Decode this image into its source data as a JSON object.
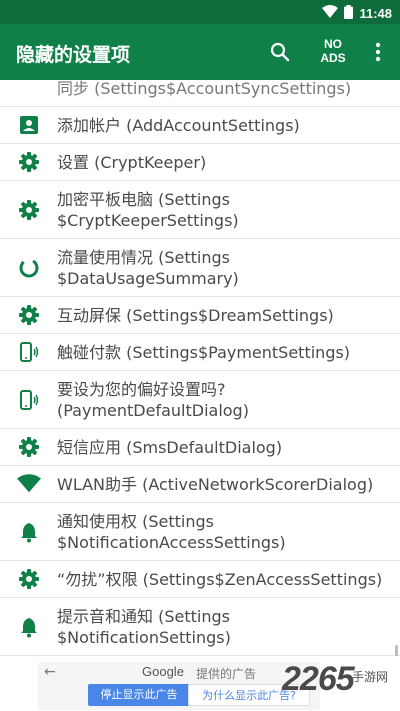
{
  "status_bar": {
    "time": "11:48",
    "icons": [
      "wifi-icon",
      "battery-icon"
    ]
  },
  "app_bar": {
    "title": "隐藏的设置项",
    "no_ads_line1": "NO",
    "no_ads_line2": "ADS",
    "icons": [
      "search-icon",
      "more-vert-icon"
    ]
  },
  "colors": {
    "primary": "#0f8048",
    "primary_dark": "#0d6b3c",
    "icon_green": "#0f8048",
    "text": "#4a4a4a"
  },
  "list": {
    "items": [
      {
        "label": "同步 (Settings$AccountSyncSettings)",
        "icon": "sync-icon"
      },
      {
        "label": "添加帐户 (AddAccountSettings)",
        "icon": "account-box-icon"
      },
      {
        "label": "设置 (CryptKeeper)",
        "icon": "gear-icon"
      },
      {
        "label": "加密平板电脑 (Settings\n$CryptKeeperSettings)",
        "icon": "gear-icon"
      },
      {
        "label": "流量使用情况 (Settings\n$DataUsageSummary)",
        "icon": "data-usage-icon"
      },
      {
        "label": "互动屏保 (Settings$DreamSettings)",
        "icon": "gear-icon"
      },
      {
        "label": "触碰付款 (Settings$PaymentSettings)",
        "icon": "nfc-phone-icon"
      },
      {
        "label": "要设为您的偏好设置吗?\n(PaymentDefaultDialog)",
        "icon": "nfc-phone-icon"
      },
      {
        "label": "短信应用 (SmsDefaultDialog)",
        "icon": "gear-icon"
      },
      {
        "label": "WLAN助手 (ActiveNetworkScorerDialog)",
        "icon": "wifi-icon"
      },
      {
        "label": "通知使用权 (Settings\n$NotificationAccessSettings)",
        "icon": "bell-icon"
      },
      {
        "label": "“勿扰”权限 (Settings$ZenAccessSettings)",
        "icon": "gear-icon"
      },
      {
        "label": "提示音和通知 (Settings\n$NotificationSettings)",
        "icon": "bell-icon"
      }
    ]
  },
  "ad": {
    "back_arrow": "←",
    "brand": "Google",
    "provided_text": "提供的广告",
    "stop_label": "停止显示此广告",
    "why_label": "为什么显示此广告?"
  },
  "watermark": {
    "number": "2265",
    "suffix": ".com",
    "site": "手游网"
  }
}
